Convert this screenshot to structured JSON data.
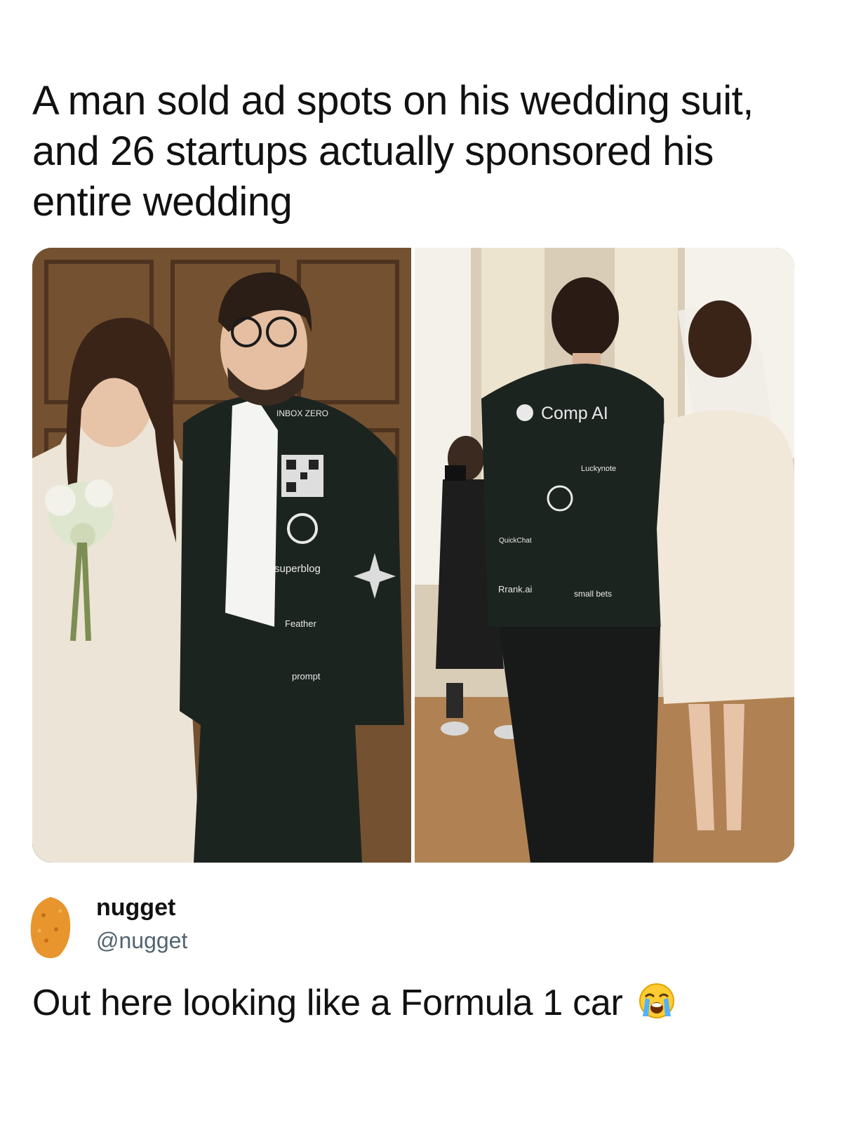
{
  "post": {
    "headline": "A man sold ad spots on his wedding suit, and 26 startups actually sponsored his entire wedding"
  },
  "photo": {
    "jacket_sponsors_front": [
      "INBOX ZERO",
      "superblog",
      "Feather",
      "prompt"
    ],
    "jacket_sponsors_back": [
      "Comp AI",
      "Luckynote",
      "QuickChat",
      "Rrank.ai",
      "small bets"
    ]
  },
  "author": {
    "display_name": "nugget",
    "handle": "@nugget"
  },
  "reply": {
    "text": "Out here looking like a Formula 1 car",
    "emoji_icon": "loudly-crying-face-icon"
  },
  "colors": {
    "text": "#111111",
    "handle": "#536471",
    "nugget": "#e8952e",
    "jacket": "#1c2420"
  }
}
